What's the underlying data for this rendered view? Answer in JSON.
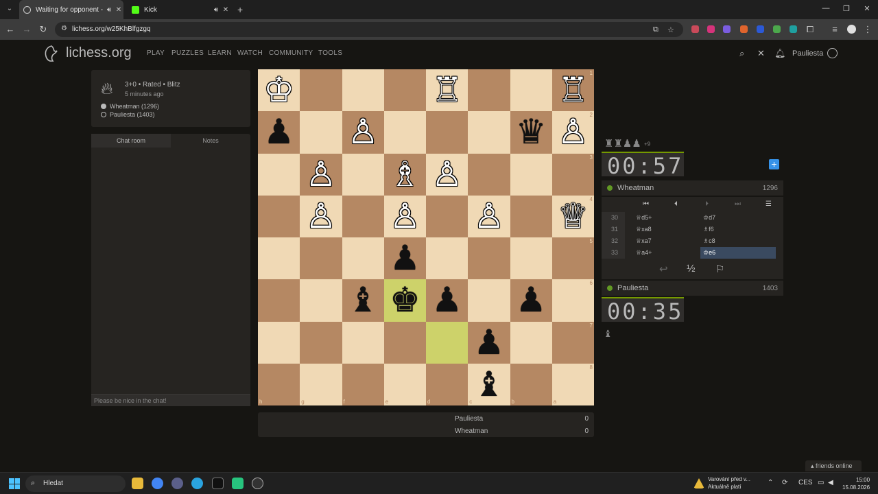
{
  "browser": {
    "tabs": [
      {
        "title": "Waiting for opponent - Pla",
        "active": true
      },
      {
        "title": "Kick",
        "active": false
      }
    ],
    "url": "lichess.org/w25KhBlfgzgq"
  },
  "site": {
    "logo_text": "lichess.org",
    "nav": [
      "PLAY",
      "PUZZLES",
      "LEARN",
      "WATCH",
      "COMMUNITY",
      "TOOLS"
    ],
    "username": "Pauliesta"
  },
  "game_info": {
    "setup": "3+0 • Rated • Blitz",
    "time_ago": "5 minutes ago",
    "players": [
      {
        "name": "Wheatman (1296)",
        "color": "white"
      },
      {
        "name": "Pauliesta (1403)",
        "color": "black"
      }
    ]
  },
  "chat": {
    "tabs": [
      "Chat room",
      "Notes"
    ],
    "placeholder": "Please be nice in the chat!"
  },
  "board": {
    "ranks": [
      "1",
      "2",
      "3",
      "4",
      "5",
      "6",
      "7",
      "8"
    ],
    "files": [
      "h",
      "g",
      "f",
      "e",
      "d",
      "c",
      "b",
      "a"
    ],
    "pieces": [
      {
        "row": 0,
        "col": 0,
        "glyph": "♔",
        "side": "w"
      },
      {
        "row": 0,
        "col": 4,
        "glyph": "♖",
        "side": "w"
      },
      {
        "row": 0,
        "col": 7,
        "glyph": "♖",
        "side": "w"
      },
      {
        "row": 1,
        "col": 0,
        "glyph": "♟",
        "side": "b"
      },
      {
        "row": 1,
        "col": 2,
        "glyph": "♙",
        "side": "w"
      },
      {
        "row": 1,
        "col": 6,
        "glyph": "♛",
        "side": "b"
      },
      {
        "row": 1,
        "col": 7,
        "glyph": "♙",
        "side": "w"
      },
      {
        "row": 2,
        "col": 1,
        "glyph": "♙",
        "side": "w"
      },
      {
        "row": 2,
        "col": 3,
        "glyph": "♗",
        "side": "w"
      },
      {
        "row": 2,
        "col": 4,
        "glyph": "♙",
        "side": "w"
      },
      {
        "row": 3,
        "col": 1,
        "glyph": "♙",
        "side": "w"
      },
      {
        "row": 3,
        "col": 3,
        "glyph": "♙",
        "side": "w"
      },
      {
        "row": 3,
        "col": 5,
        "glyph": "♙",
        "side": "w"
      },
      {
        "row": 3,
        "col": 7,
        "glyph": "♕",
        "side": "w"
      },
      {
        "row": 4,
        "col": 3,
        "glyph": "♟",
        "side": "b"
      },
      {
        "row": 5,
        "col": 2,
        "glyph": "♝",
        "side": "b"
      },
      {
        "row": 5,
        "col": 3,
        "glyph": "♚",
        "side": "b"
      },
      {
        "row": 5,
        "col": 4,
        "glyph": "♟",
        "side": "b"
      },
      {
        "row": 5,
        "col": 6,
        "glyph": "♟",
        "side": "b"
      },
      {
        "row": 6,
        "col": 5,
        "glyph": "♟",
        "side": "b"
      },
      {
        "row": 7,
        "col": 5,
        "glyph": "♝",
        "side": "b"
      }
    ],
    "highlights": [
      {
        "row": 5,
        "col": 3
      },
      {
        "row": 6,
        "col": 4
      }
    ]
  },
  "score": {
    "rows": [
      {
        "name": "Pauliesta",
        "score": "0"
      },
      {
        "name": "Wheatman",
        "score": "0"
      }
    ]
  },
  "right_panel": {
    "material": {
      "pieces": "♜♜♟♟",
      "diff": "+9"
    },
    "top_clock": "00:57",
    "top_player": {
      "name": "Wheatman",
      "rating": "1296"
    },
    "moves": [
      {
        "num": "30",
        "white": "♕d5+",
        "black": "♔d7"
      },
      {
        "num": "31",
        "white": "♕xa8",
        "black": "♗f6"
      },
      {
        "num": "32",
        "white": "♕xa7",
        "black": "♗c8"
      },
      {
        "num": "33",
        "white": "♕a4+",
        "black": "♔e6"
      }
    ],
    "draw_label": "½",
    "bottom_player": {
      "name": "Pauliesta",
      "rating": "1403"
    },
    "bottom_clock": "00:35",
    "pocket": "♝"
  },
  "taskbar": {
    "search": "Hledat",
    "warning_line1": "Varování před v...",
    "warning_line2": "Aktuálně platí",
    "lang": "CES",
    "time": "15:00",
    "date": "15.08.2026",
    "friends": "friends online"
  }
}
